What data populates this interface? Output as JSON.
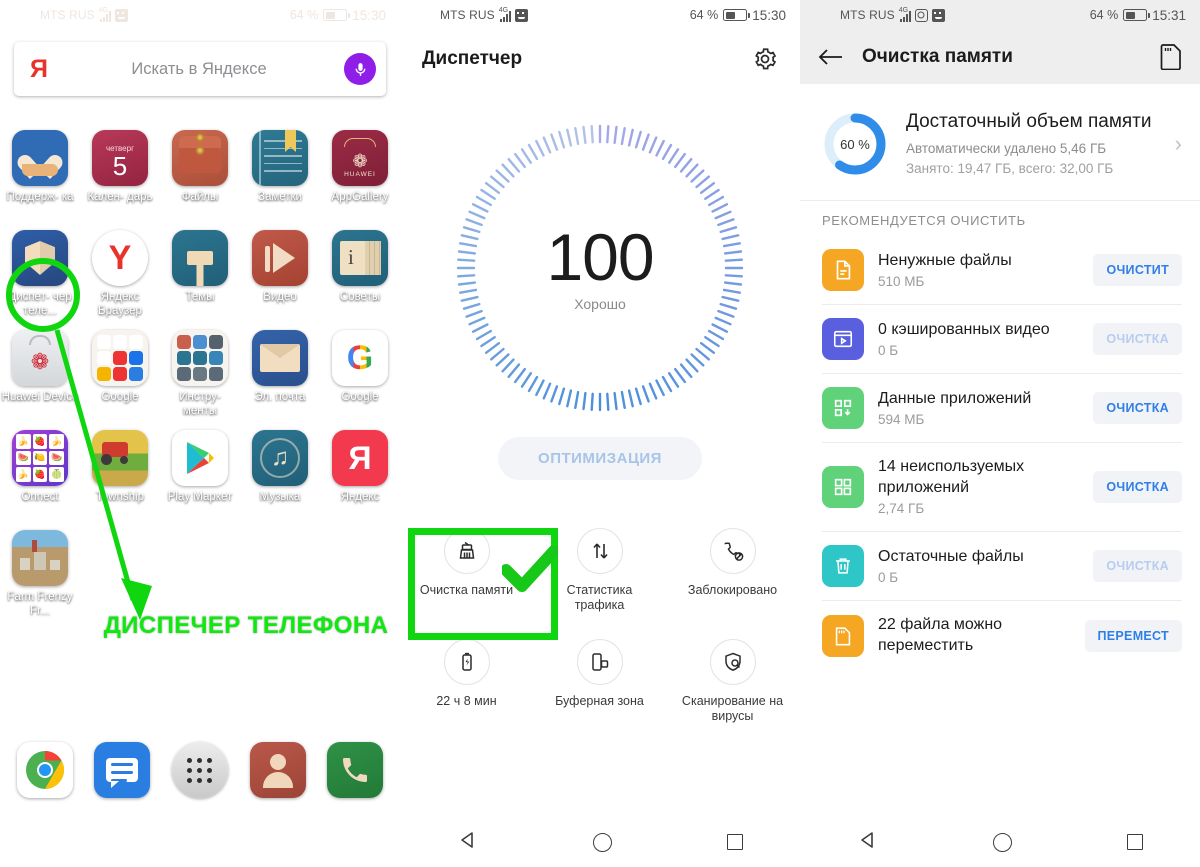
{
  "statusbar": {
    "carrier": "MTS RUS",
    "network": "4G",
    "battery_percent": "64 %",
    "time_home": "15:30",
    "time_manager": "15:30",
    "time_clean": "15:31",
    "icons": [
      "signal-icon",
      "camera-icon",
      "face-icon",
      "battery-icon"
    ]
  },
  "home": {
    "search": {
      "logo": "Я",
      "placeholder": "Искать в Яндексе",
      "mic": "microphone-icon"
    },
    "apps": [
      [
        {
          "label": "Поддерж-\nка",
          "icon": "support-app-icon"
        },
        {
          "label": "Кален-\nдарь",
          "icon": "calendar-app-icon",
          "day_of_week": "четверг",
          "day": "5"
        },
        {
          "label": "Файлы",
          "icon": "files-app-icon"
        },
        {
          "label": "Заметки",
          "icon": "notes-app-icon"
        },
        {
          "label": "AppGallery",
          "icon": "appgallery-icon",
          "brand": "HUAWEI"
        }
      ],
      [
        {
          "label": "Диспет-\nчер теле...",
          "icon": "phone-manager-icon"
        },
        {
          "label": "Яндекс\nБраузер",
          "icon": "yandex-browser-icon"
        },
        {
          "label": "Темы",
          "icon": "themes-app-icon"
        },
        {
          "label": "Видео",
          "icon": "video-app-icon"
        },
        {
          "label": "Советы",
          "icon": "tips-app-icon"
        }
      ],
      [
        {
          "label": "Huawei\nDevice",
          "icon": "huawei-device-icon"
        },
        {
          "label": "Google",
          "icon": "google-folder-icon"
        },
        {
          "label": "Инстру-\nменты",
          "icon": "tools-folder-icon"
        },
        {
          "label": "Эл. почта",
          "icon": "email-app-icon"
        },
        {
          "label": "Google",
          "icon": "google-app-icon"
        }
      ],
      [
        {
          "label": "Onnect",
          "icon": "onnect-game-icon"
        },
        {
          "label": "Township",
          "icon": "township-game-icon"
        },
        {
          "label": "Play\nМаркет",
          "icon": "play-store-icon"
        },
        {
          "label": "Музыка",
          "icon": "music-app-icon"
        },
        {
          "label": "Яндекс",
          "icon": "yandex-app-icon"
        }
      ],
      [
        {
          "label": "Farm\nFrenzy Fr...",
          "icon": "farm-frenzy-game-icon"
        }
      ]
    ],
    "annotation": {
      "text": "ДИСПЕЧЕР ТЕЛЕФОНА",
      "color": "#10e810"
    },
    "page_dots": 3,
    "active_dot": 2,
    "dock": [
      {
        "label": "chrome-icon"
      },
      {
        "label": "messages-icon"
      },
      {
        "label": "app-drawer-icon"
      },
      {
        "label": "contacts-icon"
      },
      {
        "label": "phone-icon"
      }
    ]
  },
  "manager": {
    "title": "Диспетчер",
    "settings_icon": "gear-icon",
    "score": "100",
    "score_label": "Хорошо",
    "optimize_button": "ОПТИМИЗАЦИЯ",
    "features": [
      {
        "label": "Очистка памяти",
        "icon": "broom-icon",
        "highlighted": true
      },
      {
        "label": "Статистика\nтрафика",
        "icon": "data-usage-icon"
      },
      {
        "label": "Заблокировано",
        "icon": "blocked-call-icon"
      },
      {
        "label": "22 ч 8 мин",
        "icon": "battery-icon"
      },
      {
        "label": "Буферная зона",
        "icon": "app-twin-icon"
      },
      {
        "label": "Сканирование на\nвирусы",
        "icon": "virus-scan-icon"
      }
    ]
  },
  "clean": {
    "title": "Очистка памяти",
    "back_icon": "arrow-left-icon",
    "sd_icon": "sd-card-icon",
    "summary": {
      "percent": "60 %",
      "percent_value": 60,
      "title": "Достаточный объем памяти",
      "line1": "Автоматически удалено 5,46 ГБ",
      "line2": "Занято: 19,47 ГБ, всего: 32,00 ГБ",
      "chevron": "chevron-right-icon",
      "ring_color": "#2f8ce8",
      "ring_track": "#d9ecfb"
    },
    "section_header": "РЕКОМЕНДУЕТСЯ ОЧИСТИТЬ",
    "items": [
      {
        "name": "Ненужные файлы",
        "size": "510 МБ",
        "button": "ОЧИСТИТ",
        "icon": "document-icon",
        "icon_color": "#f5a623",
        "enabled": true
      },
      {
        "name": "0 кэшированных видео",
        "size": "0 Б",
        "button": "ОЧИСТКА",
        "icon": "video-cache-icon",
        "icon_color": "#5a5fe0",
        "enabled": false
      },
      {
        "name": "Данные приложений",
        "size": "594 МБ",
        "button": "ОЧИСТКА",
        "icon": "app-data-icon",
        "icon_color": "#5fd27a",
        "enabled": true
      },
      {
        "name": "14 неиспользуемых приложений",
        "size": "2,74 ГБ",
        "button": "ОЧИСТКА",
        "icon": "unused-apps-icon",
        "icon_color": "#5fd27a",
        "enabled": true
      },
      {
        "name": "Остаточные файлы",
        "size": "0 Б",
        "button": "ОЧИСТКА",
        "icon": "trash-icon",
        "icon_color": "#2ec6c6",
        "enabled": false
      },
      {
        "name": "22 файла можно переместить",
        "size": "",
        "button": "ПЕРЕМЕСТ",
        "icon": "sd-move-icon",
        "icon_color": "#f5a623",
        "enabled": true
      }
    ]
  },
  "navbar": {
    "back": "back-triangle-icon",
    "home": "home-circle-icon",
    "recents": "recents-square-icon"
  }
}
